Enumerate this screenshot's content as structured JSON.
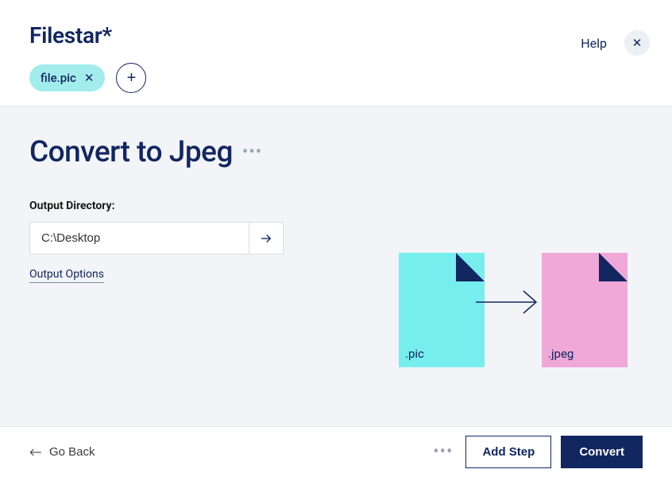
{
  "header": {
    "brand": "Filestar*",
    "file_chip": "file.pic",
    "help_label": "Help"
  },
  "page": {
    "title": "Convert to Jpeg",
    "output_dir_label": "Output Directory:",
    "output_dir_value": "C:\\Desktop",
    "output_options_label": "Output Options"
  },
  "diagram": {
    "src_ext": ".pic",
    "dst_ext": ".jpeg"
  },
  "footer": {
    "back_label": "Go Back",
    "add_step_label": "Add Step",
    "convert_label": "Convert"
  }
}
